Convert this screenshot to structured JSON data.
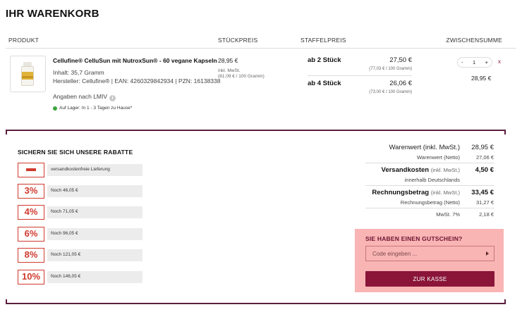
{
  "page": {
    "title": "IHR WARENKORB"
  },
  "table_headers": {
    "product": "PRODUKT",
    "unit_price": "STÜCKPREIS",
    "scale_price": "STAFFELPREIS",
    "subtotal": "ZWISCHENSUMME"
  },
  "item": {
    "name": "Cellufine® CelluSun mit NutroxSun® - 60 vegane Kapseln",
    "content": "Inhalt: 35,7 Gramm",
    "manufacturer": "Hersteller: Cellufine® | EAN: 4260329842934 | PZN: 16138338",
    "lmiv": "Angaben nach LMIV",
    "info_icon": "i",
    "stock": "Auf Lager: In 1 - 3 Tagen zu Hause*",
    "unit_price": "28,95 €",
    "unit_tax": "inkl. MwSt.",
    "unit_base": "(81,09 € / 100 Gramm)",
    "tiers": [
      {
        "label": "ab 2 Stück",
        "price": "27,50 €",
        "base": "(77,03 € / 100 Gramm)"
      },
      {
        "label": "ab 4 Stück",
        "price": "26,06 €",
        "base": "(73,00 € / 100 Gramm)"
      }
    ],
    "qty_minus": "-",
    "quantity": "1",
    "qty_plus": "+",
    "remove": "x",
    "subtotal": "28,95 €"
  },
  "discounts": {
    "title": "SICHERN SIE SICH UNSERE RABATTE",
    "rows": [
      {
        "badge": "",
        "text": "versandkostenfreie Lieferung"
      },
      {
        "badge": "3%",
        "text": "Noch 46,05 €"
      },
      {
        "badge": "4%",
        "text": "Noch 71,05 €"
      },
      {
        "badge": "6%",
        "text": "Noch 96,05 €"
      },
      {
        "badge": "8%",
        "text": "Noch 121,05 €"
      },
      {
        "badge": "10%",
        "text": "Noch 146,05 €"
      }
    ]
  },
  "summary": {
    "goods_label": "Warenwert",
    "goods_suffix": "(inkl. MwSt.)",
    "goods_value": "28,95 €",
    "goods_net_label": "Warenwert (Netto)",
    "goods_net_value": "27,06 €",
    "shipping_label": "Versandkosten",
    "shipping_suffix": "(inkl. MwSt.)",
    "shipping_value": "4,50 €",
    "shipping_note": "innerhalb Deutschlands",
    "invoice_label": "Rechnungsbetrag",
    "invoice_suffix": "(inkl. MwSt.)",
    "invoice_value": "33,45 €",
    "invoice_net_label": "Rechnungsbetrag (Netto)",
    "invoice_net_value": "31,27 €",
    "vat_label": "MwSt. 7%",
    "vat_value": "2,18 €"
  },
  "voucher": {
    "title": "SIE HABEN EINEN GUTSCHEIN?",
    "placeholder": "Code eingeben ...",
    "checkout_label": "ZUR KASSE"
  },
  "colors": {
    "brand": "#8a1538",
    "frame": "#5c1e3e",
    "discount_red": "#d03a2e",
    "voucher_bg": "#f9b4b4",
    "stock_green": "#3ba53b"
  },
  "icons": {
    "info": "info-icon",
    "stock": "in-stock-dot-icon",
    "minus_badge": "minus-icon",
    "submit": "arrow-right-icon",
    "remove": "close-icon"
  }
}
